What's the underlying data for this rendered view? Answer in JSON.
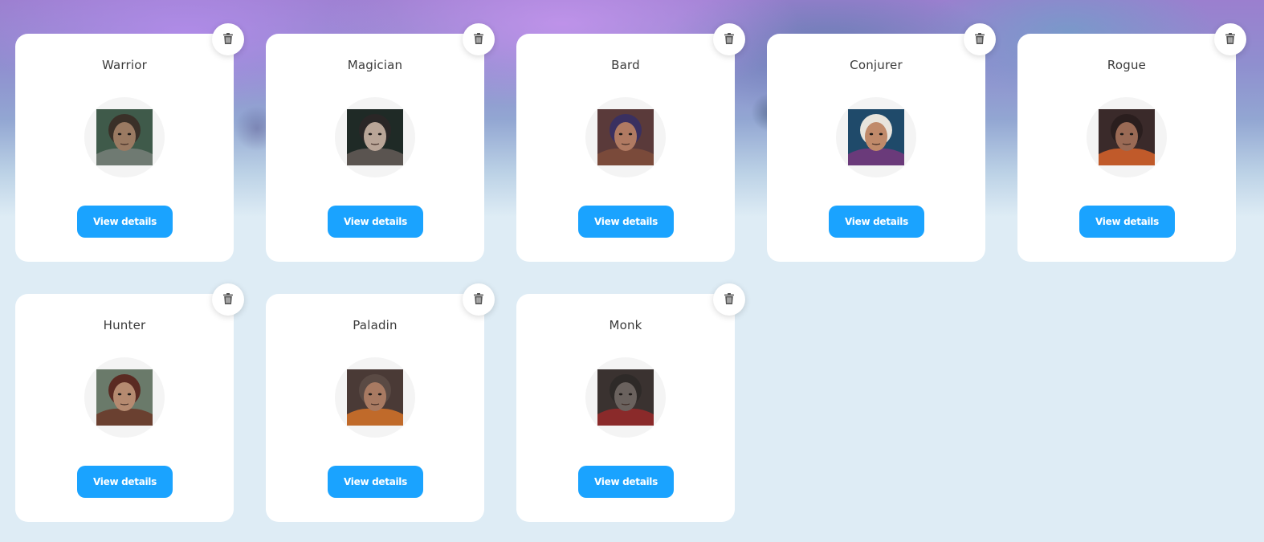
{
  "cards": [
    {
      "title": "Warrior",
      "button_label": "View details",
      "portrait": "warrior-portrait",
      "palette": {
        "bg": "#3f5a4a",
        "skin": "#9a7a62",
        "hair": "#3a3028",
        "accent": "#6f7a72"
      }
    },
    {
      "title": "Magician",
      "button_label": "View details",
      "portrait": "magician-portrait",
      "palette": {
        "bg": "#1f2a26",
        "skin": "#b9a597",
        "hair": "#2a2626",
        "accent": "#5a5450"
      }
    },
    {
      "title": "Bard",
      "button_label": "View details",
      "portrait": "bard-portrait",
      "palette": {
        "bg": "#5a3a3a",
        "skin": "#b07a62",
        "hair": "#3a3060",
        "accent": "#7a4a3a"
      }
    },
    {
      "title": "Conjurer",
      "button_label": "View details",
      "portrait": "conjurer-portrait",
      "palette": {
        "bg": "#1f4a6a",
        "skin": "#c08a6a",
        "hair": "#e8e4dc",
        "accent": "#6a3a7a"
      }
    },
    {
      "title": "Rogue",
      "button_label": "View details",
      "portrait": "rogue-portrait",
      "palette": {
        "bg": "#3a2a2a",
        "skin": "#9a6a55",
        "hair": "#2a1e1e",
        "accent": "#c05a2a"
      }
    },
    {
      "title": "Hunter",
      "button_label": "View details",
      "portrait": "hunter-portrait",
      "palette": {
        "bg": "#6a7a6a",
        "skin": "#b58a70",
        "hair": "#5a2a22",
        "accent": "#6a4030"
      }
    },
    {
      "title": "Paladin",
      "button_label": "View details",
      "portrait": "paladin-portrait",
      "palette": {
        "bg": "#4a3a36",
        "skin": "#a87a62",
        "hair": "#5a4a44",
        "accent": "#c06a2a"
      }
    },
    {
      "title": "Monk",
      "button_label": "View details",
      "portrait": "monk-portrait",
      "palette": {
        "bg": "#3a3230",
        "skin": "#6a625e",
        "hair": "#2e2a28",
        "accent": "#8a2a2a"
      }
    }
  ],
  "delete_icon": "trash-icon",
  "colors": {
    "accent": "#1aa3ff",
    "card_bg": "#ffffff",
    "page_bg": "#deecf5",
    "title_text": "#3b3b3b",
    "icon": "#555555"
  }
}
